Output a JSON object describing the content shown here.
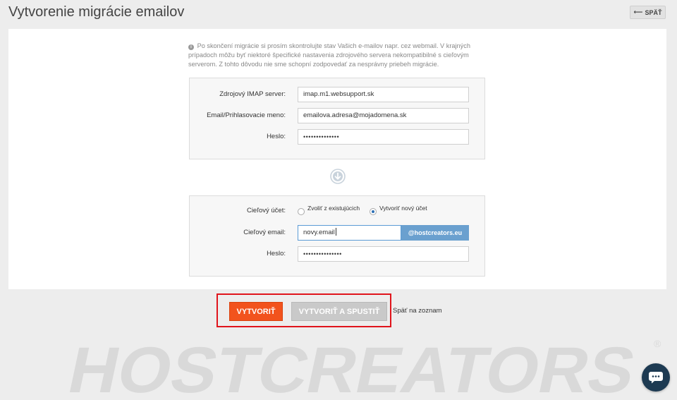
{
  "page": {
    "title": "Vytvorenie migrácie emailov"
  },
  "header": {
    "back_label": "SPÄŤ",
    "back_icon": "arrow-left-icon"
  },
  "notice": {
    "text": "Po skončení migrácie si prosím skontrolujte stav Vašich e-mailov napr. cez webmail. V krajných prípadoch môžu byť niektoré špecifické nastavenia zdrojového servera nekompatibilné s cieľovým serverom. Z tohto dôvodu nie sme schopní zodpovedať za nesprávny priebeh migrácie."
  },
  "source": {
    "imap_label": "Zdrojový IMAP server:",
    "imap_value": "imap.m1.websupport.sk",
    "login_label": "Email/Prihlasovacie meno:",
    "login_value": "emailova.adresa@mojadomena.sk",
    "password_label": "Heslo:",
    "password_value": "••••••••••••••"
  },
  "target": {
    "account_label": "Cieľový účet:",
    "option_existing": "Zvoliť z existujúcich",
    "option_new": "Vytvoriť nový účet",
    "selected_option": "new",
    "email_label": "Cieľový email:",
    "email_value": "novy.email",
    "domain": "@hostcreators.eu",
    "password_label": "Heslo:",
    "password_value": "•••••••••••••••"
  },
  "actions": {
    "create_label": "VYTVORIŤ",
    "create_run_label": "VYTVORIŤ A SPUSTIŤ",
    "back_to_list_label": "Späť na zoznam"
  },
  "branding": {
    "watermark": "HOSTCREATORS",
    "registered": "®"
  },
  "colors": {
    "accent_orange": "#f2531d",
    "domain_blue": "#6aa0cf",
    "highlight_red": "#e0141b",
    "chat_navy": "#1d3a52"
  }
}
